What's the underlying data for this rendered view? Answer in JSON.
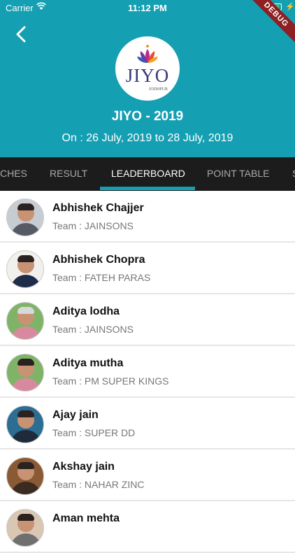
{
  "status_bar": {
    "carrier": "Carrier",
    "time": "11:12 PM"
  },
  "debug_banner": "DEBUG",
  "event": {
    "logo_word": "JIYO",
    "logo_sub": "JODHPUR",
    "title": "JIYO - 2019",
    "dates": "On : 26 July, 2019 to 28 July, 2019"
  },
  "tabs": [
    {
      "label": "CHES"
    },
    {
      "label": "RESULT"
    },
    {
      "label": "LEADERBOARD"
    },
    {
      "label": "POINT TABLE"
    },
    {
      "label": "S"
    }
  ],
  "active_tab": "LEADERBOARD",
  "players": [
    {
      "name": "Abhishek Chajjer",
      "team": "Team : JAINSONS"
    },
    {
      "name": "Abhishek Chopra",
      "team": "Team : FATEH PARAS"
    },
    {
      "name": "Aditya lodha",
      "team": "Team : JAINSONS"
    },
    {
      "name": "Aditya mutha",
      "team": "Team : PM SUPER KINGS"
    },
    {
      "name": "Ajay jain",
      "team": "Team : SUPER DD"
    },
    {
      "name": "Akshay jain",
      "team": "Team : NAHAR ZINC"
    },
    {
      "name": "Aman mehta",
      "team": ""
    }
  ],
  "colors": {
    "primary": "#149fb3",
    "tabbar": "#1c1c1c",
    "debug": "#8e1f22"
  }
}
